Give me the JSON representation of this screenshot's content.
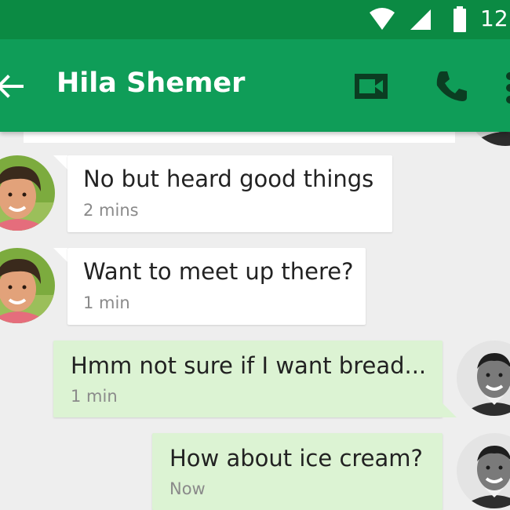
{
  "status_bar": {
    "time": "12:",
    "icons": [
      "wifi-icon",
      "cell-signal-icon",
      "battery-icon"
    ]
  },
  "app_bar": {
    "title": "Hila Shemer",
    "back_icon": "arrow-left-icon",
    "video_icon": "videocam-icon",
    "call_icon": "phone-icon",
    "overflow_icon": "more-vert-icon"
  },
  "colors": {
    "status_bar": "#0b8a43",
    "app_bar": "#0f9d58",
    "background": "#eeeeee",
    "incoming_bubble": "#ffffff",
    "outgoing_bubble": "#dcf3d3",
    "message_text": "#222222",
    "timestamp_text": "#8a8a8a"
  },
  "messages": [
    {
      "direction": "incoming",
      "text": "No but heard good things",
      "time": "2 mins"
    },
    {
      "direction": "incoming",
      "text": "Want to meet up there?",
      "time": "1 min"
    },
    {
      "direction": "outgoing",
      "text": "Hmm not sure if I want bread...",
      "time": "1 min"
    },
    {
      "direction": "outgoing",
      "text": "How about ice cream?",
      "time": "Now"
    }
  ]
}
